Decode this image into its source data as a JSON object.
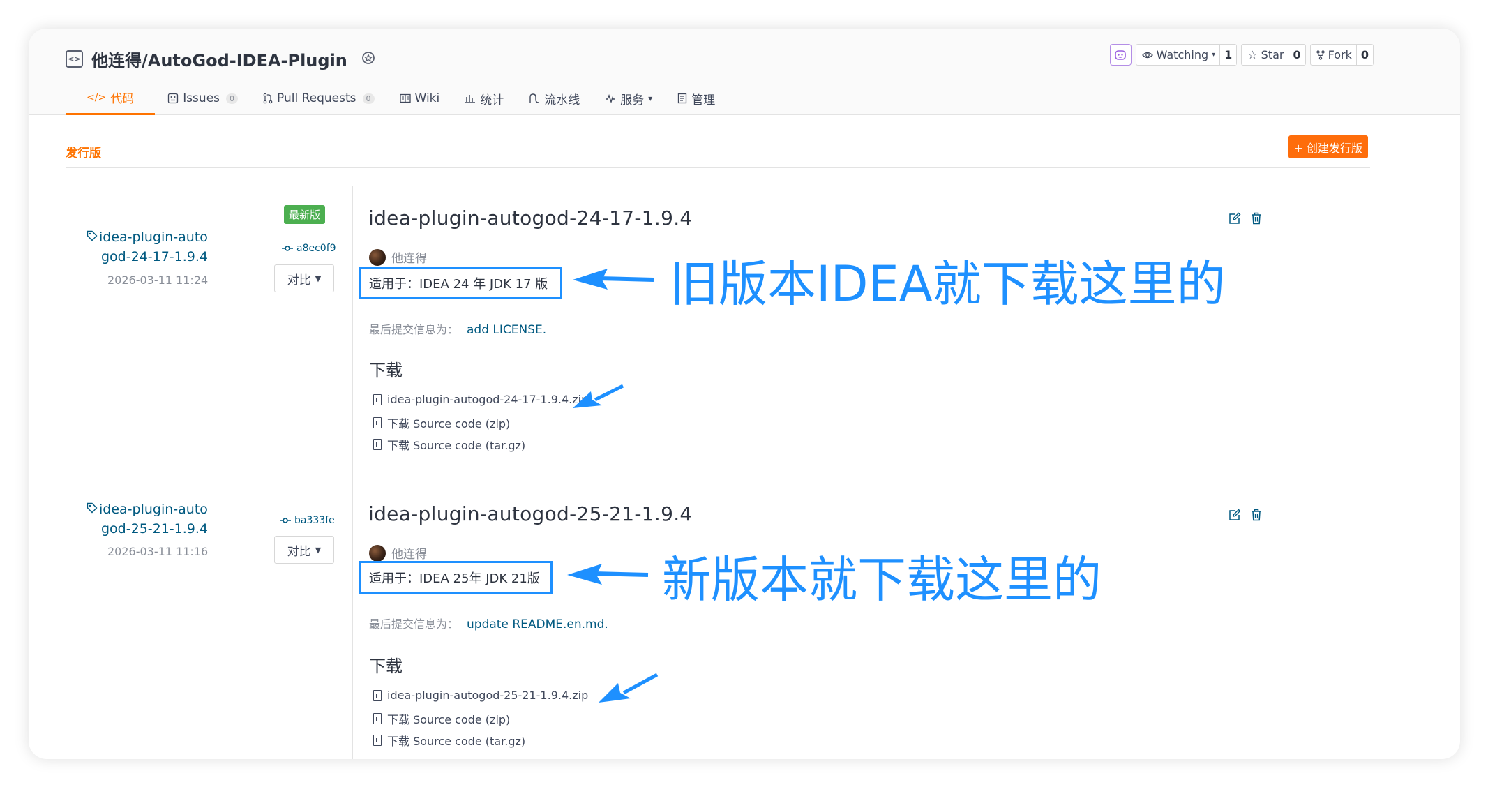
{
  "repo": {
    "name": "他连得/AutoGod-IDEA-Plugin",
    "repo_icon": "code-bracket-icon",
    "award_icon": "award-icon"
  },
  "actions": {
    "watch": {
      "label": "Watching",
      "count": "1"
    },
    "star": {
      "label": "Star",
      "count": "0"
    },
    "fork": {
      "label": "Fork",
      "count": "0"
    }
  },
  "tabs": [
    {
      "label": "代码",
      "icon": "code-icon"
    },
    {
      "label": "Issues",
      "icon": "issues-icon",
      "badge": "0"
    },
    {
      "label": "Pull Requests",
      "icon": "pull-request-icon",
      "badge": "0"
    },
    {
      "label": "Wiki",
      "icon": "wiki-icon"
    },
    {
      "label": "统计",
      "icon": "stats-icon"
    },
    {
      "label": "流水线",
      "icon": "pipeline-icon"
    },
    {
      "label": "服务",
      "icon": "service-icon"
    },
    {
      "label": "管理",
      "icon": "manage-icon"
    }
  ],
  "section": {
    "title": "发行版",
    "create_label": "+ 创建发行版"
  },
  "releases": [
    {
      "tag_line1": "idea-plugin-auto",
      "tag_line2": "god-24-17-1.9.4",
      "date": "2026-03-11 11:24",
      "latest_badge": "最新版",
      "commit": "a8ec0f9",
      "compare": "对比",
      "title": "idea-plugin-autogod-24-17-1.9.4",
      "author": "他连得",
      "description": "适用于：IDEA 24 年 JDK 17 版",
      "commit_label": "最后提交信息为：",
      "commit_msg": "add LICENSE.",
      "download_heading": "下载",
      "downloads": [
        "idea-plugin-autogod-24-17-1.9.4.zip",
        "下载 Source code (zip)",
        "下载 Source code (tar.gz)"
      ],
      "annotation": "旧版本IDEA就下载这里的"
    },
    {
      "tag_line1": "idea-plugin-auto",
      "tag_line2": "god-25-21-1.9.4",
      "date": "2026-03-11 11:16",
      "commit": "ba333fe",
      "compare": "对比",
      "title": "idea-plugin-autogod-25-21-1.9.4",
      "author": "他连得",
      "description": "适用于：IDEA 25年 JDK 21版",
      "commit_label": "最后提交信息为：",
      "commit_msg": "update README.en.md.",
      "download_heading": "下载",
      "downloads": [
        "idea-plugin-autogod-25-21-1.9.4.zip",
        "下载 Source code (zip)",
        "下载 Source code (tar.gz)"
      ],
      "annotation": "新版本就下载这里的"
    }
  ],
  "colors": {
    "accent": "#fe7300",
    "annotation": "#1e90ff",
    "link": "#005980",
    "badge_green": "#4caf50"
  }
}
